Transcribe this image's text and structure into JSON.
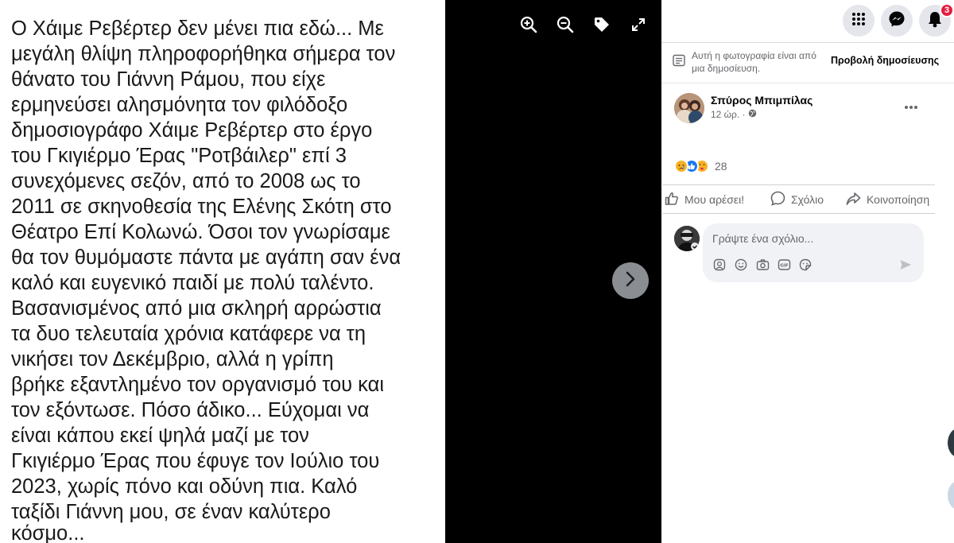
{
  "post_image": {
    "lines": [
      "Ο Χάιμε Ρεβέρτερ δεν μένει πια εδώ... Με",
      "μεγάλη θλίψη πληροφορήθηκα σήμερα τον",
      "θάνατο του Γιάννη Ράμου, που είχε",
      "ερμηνεύσει αλησμόνητα τον φιλόδοξο",
      "δημοσιογράφο Χάιμε Ρεβέρτερ στο έργο",
      "του Γκιγιέρμο Έρας \"Ροτβάιλερ\" επί 3",
      "συνεχόμενες σεζόν, από το 2008 ως το",
      "2011 σε σκηνοθεσία της Ελένης Σκότη στο",
      "Θέατρο Επί Κολωνώ. Όσοι τον γνωρίσαμε",
      "θα τον θυμόμαστε πάντα με αγάπη σαν ένα",
      "καλό και ευγενικό παιδί με πολύ ταλέντο.",
      "Βασανισμένος από μια σκληρή αρρώστια",
      "τα δυο τελευταία χρόνια κατάφερε να τη",
      "νικήσει τον Δεκέμβριο, αλλά η γρίπη",
      "βρήκε εξαντλημένο τον οργανισμό του και",
      "τον εξόντωσε. Πόσο άδικο... Εύχομαι να",
      "είναι κάπου εκεί ψηλά μαζί με τον",
      "Γκιγιέρμο Έρας που έφυγε τον Ιούλιο του",
      "2023, χωρίς πόνο και οδύνη πια. Καλό",
      "ταξίδι Γιάννη μου, σε έναν καλύτερο",
      "κόσμο..."
    ]
  },
  "viewer_toolbar": {
    "icons": [
      "zoom-in-icon",
      "zoom-out-icon",
      "tag-icon",
      "fullscreen-icon"
    ]
  },
  "top_nav": {
    "icons": [
      "menu-grid-icon",
      "messenger-icon",
      "bell-icon"
    ],
    "notification_count": "3"
  },
  "info_banner": {
    "text": "Αυτή η φωτογραφία είναι από μια δημοσίευση.",
    "link_label": "Προβολή δημοσίευσης"
  },
  "post": {
    "author": "Σπύρος Μπιμπίλας",
    "time": "12 ώρ. ·",
    "reaction_count": "28"
  },
  "actions": {
    "like": "Μου αρέσει!",
    "comment": "Σχόλιο",
    "share": "Κοινοποίηση"
  },
  "comment_box": {
    "placeholder": "Γράψτε ένα σχόλιο..."
  },
  "colors": {
    "like_blue": "#1877f2",
    "notification_red": "#e41e3f",
    "photo_background": "#000000",
    "panel_background": "#ffffff"
  }
}
